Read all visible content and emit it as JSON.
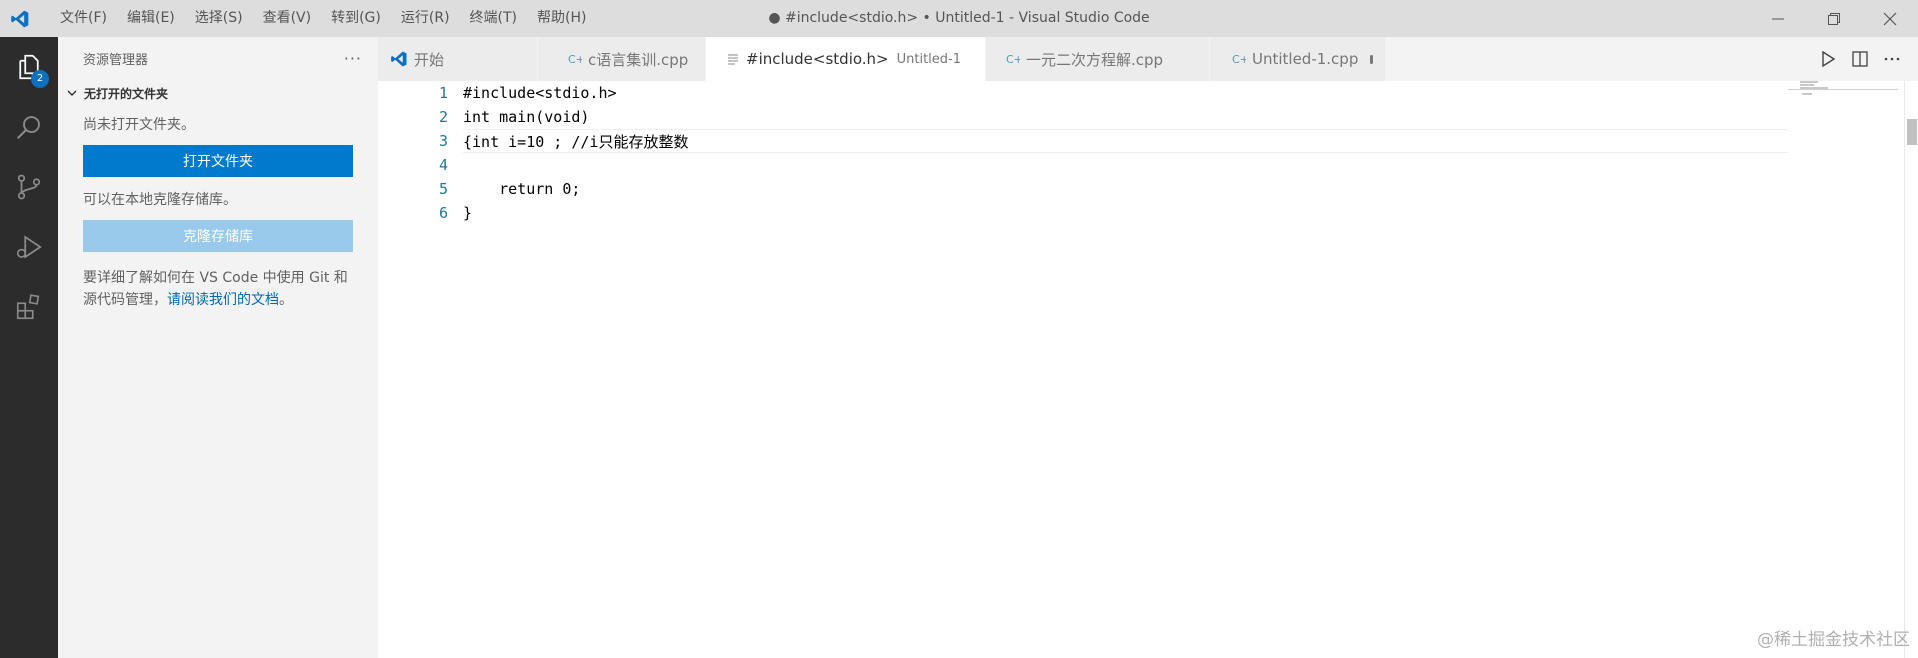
{
  "titlebar": {
    "menu": [
      "文件(F)",
      "编辑(E)",
      "选择(S)",
      "查看(V)",
      "转到(G)",
      "运行(R)",
      "终端(T)",
      "帮助(H)"
    ],
    "title": "● #include<stdio.h> • Untitled-1 - Visual Studio Code"
  },
  "activity": {
    "badge": "2",
    "items": [
      "explorer-icon",
      "search-icon",
      "source-control-icon",
      "run-debug-icon",
      "extensions-icon"
    ]
  },
  "sidebar": {
    "header": "资源管理器",
    "more": "···",
    "section_title": "无打开的文件夹",
    "no_folder_text": "尚未打开文件夹。",
    "open_folder_button": "打开文件夹",
    "clone_text": "可以在本地克隆存储库。",
    "clone_button": "克隆存储库",
    "help_text": "要详细了解如何在 VS Code 中使用 Git 和源代码管理，",
    "help_link": "请阅读我们的文档",
    "help_end": "。"
  },
  "tabs": [
    {
      "label": "开始",
      "desc": "",
      "dirty": false,
      "active": false,
      "icon": "vscode-logo-icon"
    },
    {
      "label": "c语言集训.cpp",
      "desc": "",
      "dirty": false,
      "active": false,
      "icon": "cpp-file-icon"
    },
    {
      "label": "#include<stdio.h>",
      "desc": "Untitled-1",
      "dirty": true,
      "active": true,
      "icon": "text-file-icon"
    },
    {
      "label": "一元二次方程解.cpp",
      "desc": "",
      "dirty": false,
      "active": false,
      "icon": "cpp-file-icon"
    },
    {
      "label": "Untitled-1.cpp",
      "desc": "",
      "dirty": true,
      "active": false,
      "icon": "cpp-file-icon"
    }
  ],
  "editor": {
    "line_numbers": [
      "1",
      "2",
      "3",
      "4",
      "5",
      "6"
    ],
    "lines": [
      "#include<stdio.h>",
      "int main(void)",
      "{int i=10 ; //i只能存放整数",
      "",
      "    return 0;",
      "}"
    ],
    "current_line": 3
  },
  "watermark": "@稀土掘金技术社区",
  "colors": {
    "accent": "#007acc",
    "activity_bg": "#2c2c2c",
    "sidebar_bg": "#f3f3f3",
    "line_number": "#237893"
  }
}
